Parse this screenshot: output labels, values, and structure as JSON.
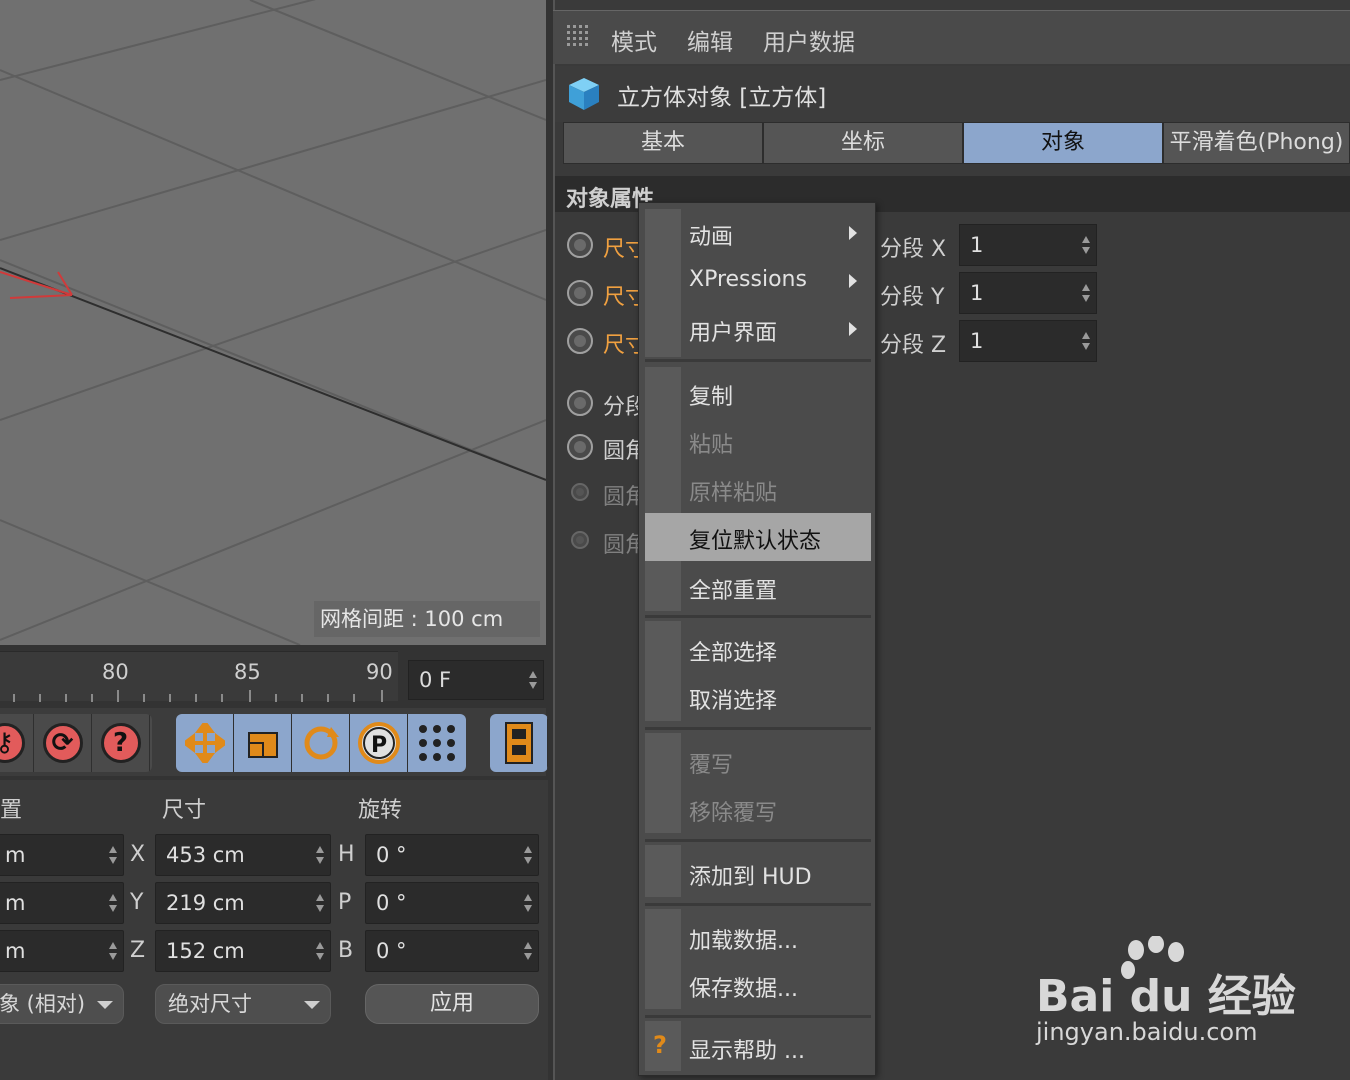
{
  "viewport": {
    "grid_spacing_text": "网格间距 : 100 cm"
  },
  "timeline": {
    "ticks": [
      "80",
      "85",
      "90"
    ],
    "current_frame": "0 F"
  },
  "coords": {
    "headers": {
      "position": "置",
      "size": "尺寸",
      "rotation": "旋转"
    },
    "position_values": [
      "m",
      "m",
      "m"
    ],
    "size_axes": [
      "X",
      "Y",
      "Z"
    ],
    "size_values": [
      "453 cm",
      "219 cm",
      "152 cm"
    ],
    "rot_axes": [
      "H",
      "P",
      "B"
    ],
    "rot_values": [
      "0 °",
      "0 °",
      "0 °"
    ],
    "mode_dropdown": "象 (相对)",
    "size_dropdown": "绝对尺寸",
    "apply_label": "应用"
  },
  "attr": {
    "menu": [
      "模式",
      "编辑",
      "用户数据"
    ],
    "object_title": "立方体对象 [立方体]",
    "tabs": [
      {
        "label": "基本",
        "active": false
      },
      {
        "label": "坐标",
        "active": false
      },
      {
        "label": "对象",
        "active": true
      },
      {
        "label": "平滑着色(Phong)",
        "active": false
      }
    ],
    "section_title": "对象属性",
    "props": [
      "尺寸",
      "尺寸",
      "尺寸",
      "分段",
      "圆角",
      "圆角",
      "圆角"
    ],
    "segments": [
      {
        "label": "分段 X",
        "value": "1"
      },
      {
        "label": "分段 Y",
        "value": "1"
      },
      {
        "label": "分段 Z",
        "value": "1"
      }
    ]
  },
  "context_menu": {
    "items": {
      "animation": "动画",
      "xpressions": "XPressions",
      "user_interface": "用户界面",
      "copy": "复制",
      "paste": "粘贴",
      "paste_in_place": "原样粘贴",
      "reset_default": "复位默认状态",
      "reset_all": "全部重置",
      "select_all": "全部选择",
      "deselect": "取消选择",
      "override": "覆写",
      "remove_override": "移除覆写",
      "add_to_hud": "添加到 HUD",
      "load_data": "加载数据...",
      "save_data": "保存数据...",
      "show_help": "显示帮助 ..."
    },
    "highlighted": "reset_default"
  },
  "watermark": {
    "brand": "Bai du 经验",
    "url": "jingyan.baidu.com"
  },
  "colors": {
    "accent_blue": "#8ca6cc",
    "orange_label": "#f0a040",
    "bg_dark": "#3a3a3a"
  }
}
